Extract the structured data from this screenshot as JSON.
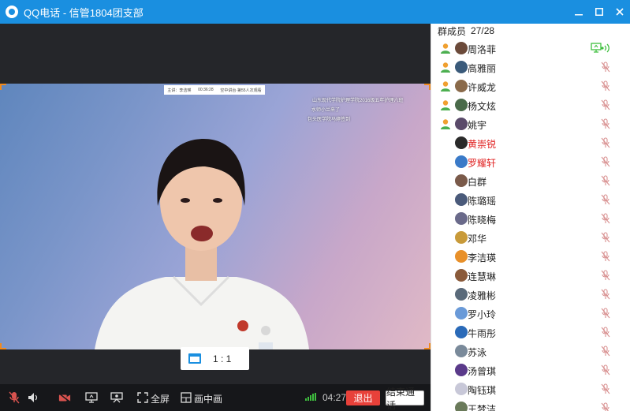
{
  "window": {
    "title": "QQ电话 - 信管1804团支部",
    "controls": [
      "minimize-icon",
      "maximize-icon",
      "close-icon"
    ],
    "accent_color": "#1a8fe0"
  },
  "video": {
    "overlay": {
      "live_bar": [
        "主讲：李洁瑛",
        "00:36:28",
        "空中讲台·第55人次观看"
      ],
      "danmaku": [
        "山东现代学院护理学院2016级五年护理六班",
        "水师小兰来了",
        "包头医学院马婷签到"
      ]
    },
    "aspect_button_label": "1 : 1"
  },
  "toolbar": {
    "mute_mic_icon": "mic-muted-icon",
    "speaker_icon": "speaker-icon",
    "camera_off_icon": "camera-off-icon",
    "share_screen_icon": "share-screen-icon",
    "presentation_icon": "presentation-icon",
    "fullscreen_label": "全屏",
    "pip_label": "画中画",
    "signal_icon": "signal-strength-icon",
    "call_duration": "04:27",
    "exit_label": "退出",
    "end_call_label": "结束通话"
  },
  "panel": {
    "title": "群成员",
    "count": "27/28",
    "members": [
      {
        "name": "周洛菲",
        "admin": true,
        "red": false,
        "status": "sharing-speaking",
        "avatar_color": "#6b4a3a"
      },
      {
        "name": "高雅丽",
        "admin": true,
        "red": false,
        "status": "muted",
        "avatar_color": "#3a5a7a"
      },
      {
        "name": "许威龙",
        "admin": true,
        "red": false,
        "status": "muted",
        "avatar_color": "#8a6a4a"
      },
      {
        "name": "杨文炫",
        "admin": true,
        "red": false,
        "status": "muted",
        "avatar_color": "#4a6a4a"
      },
      {
        "name": "姚宇",
        "admin": true,
        "red": false,
        "status": "muted",
        "avatar_color": "#5a4a6a"
      },
      {
        "name": "黄崇锐",
        "admin": false,
        "red": true,
        "status": "muted",
        "avatar_color": "#2a2a2a"
      },
      {
        "name": "罗耀轩",
        "admin": false,
        "red": true,
        "status": "muted",
        "avatar_color": "#3a7ac8"
      },
      {
        "name": "白群",
        "admin": false,
        "red": false,
        "status": "muted",
        "avatar_color": "#7a5a4a"
      },
      {
        "name": "陈璐瑶",
        "admin": false,
        "red": false,
        "status": "muted",
        "avatar_color": "#4a5a7a"
      },
      {
        "name": "陈晓梅",
        "admin": false,
        "red": false,
        "status": "muted",
        "avatar_color": "#6a6a8a"
      },
      {
        "name": "邓华",
        "admin": false,
        "red": false,
        "status": "muted",
        "avatar_color": "#c89a3a"
      },
      {
        "name": "李洁瑛",
        "admin": false,
        "red": false,
        "status": "muted",
        "avatar_color": "#e8902a"
      },
      {
        "name": "连慧琳",
        "admin": false,
        "red": false,
        "status": "muted",
        "avatar_color": "#8a5a3a"
      },
      {
        "name": "凌雅彬",
        "admin": false,
        "red": false,
        "status": "muted",
        "avatar_color": "#5a6a7a"
      },
      {
        "name": "罗小玲",
        "admin": false,
        "red": false,
        "status": "muted",
        "avatar_color": "#6a9ad8"
      },
      {
        "name": "牛雨彤",
        "admin": false,
        "red": false,
        "status": "muted",
        "avatar_color": "#2a6ab8"
      },
      {
        "name": "苏泳",
        "admin": false,
        "red": false,
        "status": "muted",
        "avatar_color": "#7a8a9a"
      },
      {
        "name": "汤曾琪",
        "admin": false,
        "red": false,
        "status": "muted",
        "avatar_color": "#5a3a8a"
      },
      {
        "name": "陶钰琪",
        "admin": false,
        "red": false,
        "status": "muted",
        "avatar_color": "#c8c8d8"
      },
      {
        "name": "王梦洁",
        "admin": false,
        "red": false,
        "status": "muted",
        "avatar_color": "#6a7a5a"
      }
    ]
  }
}
